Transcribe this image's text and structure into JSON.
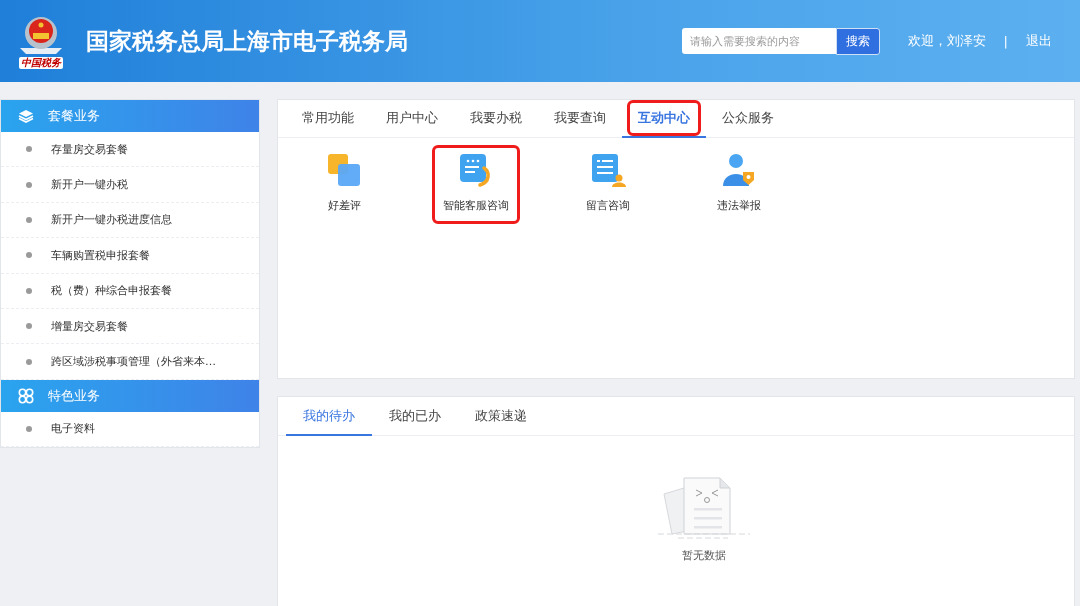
{
  "header": {
    "logo_caption": "中国税务",
    "title": "国家税务总局上海市电子税务局",
    "search": {
      "placeholder": "请输入需要搜索的内容",
      "button": "搜索"
    },
    "welcome": "欢迎，刘泽安",
    "separator": "|",
    "logout": "退出"
  },
  "sidebar": {
    "groups": [
      {
        "title": "套餐业务",
        "kind": "layers",
        "items": [
          "存量房交易套餐",
          "新开户一键办税",
          "新开户一键办税进度信息",
          "车辆购置税申报套餐",
          "税（费）种综合申报套餐",
          "增量房交易套餐",
          "跨区域涉税事项管理（外省来本…"
        ]
      },
      {
        "title": "特色业务",
        "kind": "clover",
        "items": [
          "电子资料"
        ]
      }
    ]
  },
  "function_panel": {
    "tabs": [
      {
        "label": "常用功能",
        "selected": false,
        "highlighted": false
      },
      {
        "label": "用户中心",
        "selected": false,
        "highlighted": false
      },
      {
        "label": "我要办税",
        "selected": false,
        "highlighted": false
      },
      {
        "label": "我要查询",
        "selected": false,
        "highlighted": false
      },
      {
        "label": "互动中心",
        "selected": true,
        "highlighted": true
      },
      {
        "label": "公众服务",
        "selected": false,
        "highlighted": false
      }
    ],
    "items": [
      {
        "label": "好差评",
        "kind": "squares",
        "highlighted": false
      },
      {
        "label": "智能客服咨询",
        "kind": "chat",
        "highlighted": true
      },
      {
        "label": "留言咨询",
        "kind": "message",
        "highlighted": false
      },
      {
        "label": "违法举报",
        "kind": "report",
        "highlighted": false
      }
    ]
  },
  "task_panel": {
    "tabs": [
      {
        "label": "我的待办",
        "selected": true
      },
      {
        "label": "我的已办",
        "selected": false
      },
      {
        "label": "政策速递",
        "selected": false
      }
    ],
    "empty_text": "暂无数据"
  }
}
